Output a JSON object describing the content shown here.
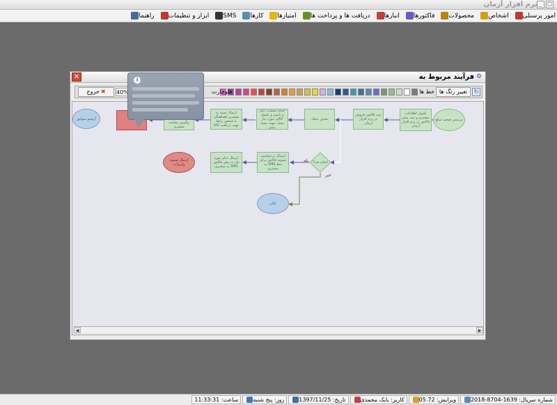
{
  "window": {
    "title": "نرم افزار آرمان"
  },
  "menu": {
    "items": [
      {
        "label": "امور پرسنلی",
        "icon": "personnel-icon",
        "color": "#c0392b"
      },
      {
        "label": "اشخاص",
        "icon": "people-icon",
        "color": "#d4a017"
      },
      {
        "label": "محصولات",
        "icon": "products-icon",
        "color": "#b8860b"
      },
      {
        "label": "فاکتورها",
        "icon": "invoices-icon",
        "color": "#6a5acd"
      },
      {
        "label": "انبارها",
        "icon": "warehouse-icon",
        "color": "#c04040"
      },
      {
        "label": "دریافت ها و پرداخت ها",
        "icon": "payments-icon",
        "color": "#6b8e23"
      },
      {
        "label": "امتیازها",
        "icon": "star-icon",
        "color": "#e6b800"
      },
      {
        "label": "کارها",
        "icon": "tasks-icon",
        "color": "#5a8ab8"
      },
      {
        "label": "SMS",
        "icon": "sms-icon",
        "color": "#333333"
      },
      {
        "label": "ابزار و تنظیمات",
        "icon": "tools-icon",
        "color": "#c0392b"
      },
      {
        "label": "راهنما",
        "icon": "help-icon",
        "color": "#4a6aa0"
      }
    ]
  },
  "dialog": {
    "title": "فرآیند مربوط به",
    "toolbar": {
      "change_colors_label": "تغییر رنگ ها",
      "line_label": "خط ها",
      "flowchart_label": "فلوچارت",
      "zoom": "40%",
      "exit_label": "خروج",
      "swatches": [
        "#7a7a7a",
        "#ffffff",
        "#c8e2c5",
        "#8fc08a",
        "#7a9a6a",
        "#6a6ad0",
        "#5a8ab8",
        "#4a6aa0",
        "#3a9ab8",
        "#2a5a9a",
        "#1a3a7a",
        "#8ab8e8",
        "#c8b8d8",
        "#e8d830",
        "#d8c040",
        "#c8a050",
        "#e8a030",
        "#d88020",
        "#b86040",
        "#8a4020",
        "#c84040",
        "#e85050",
        "#d8408a",
        "#b8409a",
        "#a040b8",
        "#e860c8"
      ]
    }
  },
  "flow": {
    "nodes": {
      "n1": "بررسی صحت مبلغ",
      "n2": "تکمیل اطلاعات مشتری و ثبت پیش فاکتور در نرم افزار آرمان",
      "n3": "ثبت فاکتور فروش در نرم افزار آرمان",
      "n4": "صدور بیجک",
      "n5": "انجام عملیات انبار و تامین و تکمیل کالای مورد نیاز بیجک جهت بسته بندی",
      "n6": "ارسال بسته به مشتری (هماهنگی با شخص رابط جهت دریافت کالا)",
      "n7": "بعد از دو هفته تماس جهت پیگیری رضایت مشتری",
      "n9": "آرشیو سوابق",
      "d1": "انجام شد؟",
      "n10": "ارسال درخواست تسویه فاکتور برای خط SMS به مشتری",
      "n11": "ارسال تذکر مورد نیاز به پیش فاکتور SMS به مشتری",
      "n12": "ارسال تسویه واریزات",
      "n13": "پایان"
    },
    "labels": {
      "yes": "بله",
      "no": "خیر"
    }
  },
  "status": {
    "serial": "شماره سریال: 1639-8704-2018",
    "version": "ویرایش: 05.72",
    "user": "کاربر: بابک محمدی",
    "date": "تاریخ: 1397/11/25",
    "weekday": "روز: پنج شنبه",
    "time": "ساعت: 11:33:31"
  }
}
